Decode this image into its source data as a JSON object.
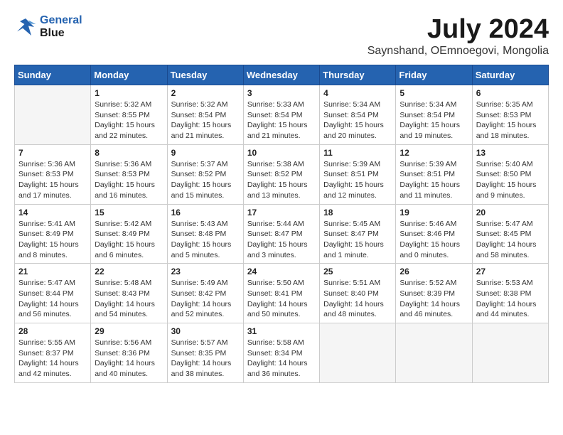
{
  "header": {
    "logo_line1": "General",
    "logo_line2": "Blue",
    "month_year": "July 2024",
    "location": "Saynshand, OEmnoegovi, Mongolia"
  },
  "days_of_week": [
    "Sunday",
    "Monday",
    "Tuesday",
    "Wednesday",
    "Thursday",
    "Friday",
    "Saturday"
  ],
  "weeks": [
    [
      {
        "num": "",
        "info": ""
      },
      {
        "num": "1",
        "info": "Sunrise: 5:32 AM\nSunset: 8:55 PM\nDaylight: 15 hours\nand 22 minutes."
      },
      {
        "num": "2",
        "info": "Sunrise: 5:32 AM\nSunset: 8:54 PM\nDaylight: 15 hours\nand 21 minutes."
      },
      {
        "num": "3",
        "info": "Sunrise: 5:33 AM\nSunset: 8:54 PM\nDaylight: 15 hours\nand 21 minutes."
      },
      {
        "num": "4",
        "info": "Sunrise: 5:34 AM\nSunset: 8:54 PM\nDaylight: 15 hours\nand 20 minutes."
      },
      {
        "num": "5",
        "info": "Sunrise: 5:34 AM\nSunset: 8:54 PM\nDaylight: 15 hours\nand 19 minutes."
      },
      {
        "num": "6",
        "info": "Sunrise: 5:35 AM\nSunset: 8:53 PM\nDaylight: 15 hours\nand 18 minutes."
      }
    ],
    [
      {
        "num": "7",
        "info": "Sunrise: 5:36 AM\nSunset: 8:53 PM\nDaylight: 15 hours\nand 17 minutes."
      },
      {
        "num": "8",
        "info": "Sunrise: 5:36 AM\nSunset: 8:53 PM\nDaylight: 15 hours\nand 16 minutes."
      },
      {
        "num": "9",
        "info": "Sunrise: 5:37 AM\nSunset: 8:52 PM\nDaylight: 15 hours\nand 15 minutes."
      },
      {
        "num": "10",
        "info": "Sunrise: 5:38 AM\nSunset: 8:52 PM\nDaylight: 15 hours\nand 13 minutes."
      },
      {
        "num": "11",
        "info": "Sunrise: 5:39 AM\nSunset: 8:51 PM\nDaylight: 15 hours\nand 12 minutes."
      },
      {
        "num": "12",
        "info": "Sunrise: 5:39 AM\nSunset: 8:51 PM\nDaylight: 15 hours\nand 11 minutes."
      },
      {
        "num": "13",
        "info": "Sunrise: 5:40 AM\nSunset: 8:50 PM\nDaylight: 15 hours\nand 9 minutes."
      }
    ],
    [
      {
        "num": "14",
        "info": "Sunrise: 5:41 AM\nSunset: 8:49 PM\nDaylight: 15 hours\nand 8 minutes."
      },
      {
        "num": "15",
        "info": "Sunrise: 5:42 AM\nSunset: 8:49 PM\nDaylight: 15 hours\nand 6 minutes."
      },
      {
        "num": "16",
        "info": "Sunrise: 5:43 AM\nSunset: 8:48 PM\nDaylight: 15 hours\nand 5 minutes."
      },
      {
        "num": "17",
        "info": "Sunrise: 5:44 AM\nSunset: 8:47 PM\nDaylight: 15 hours\nand 3 minutes."
      },
      {
        "num": "18",
        "info": "Sunrise: 5:45 AM\nSunset: 8:47 PM\nDaylight: 15 hours\nand 1 minute."
      },
      {
        "num": "19",
        "info": "Sunrise: 5:46 AM\nSunset: 8:46 PM\nDaylight: 15 hours\nand 0 minutes."
      },
      {
        "num": "20",
        "info": "Sunrise: 5:47 AM\nSunset: 8:45 PM\nDaylight: 14 hours\nand 58 minutes."
      }
    ],
    [
      {
        "num": "21",
        "info": "Sunrise: 5:47 AM\nSunset: 8:44 PM\nDaylight: 14 hours\nand 56 minutes."
      },
      {
        "num": "22",
        "info": "Sunrise: 5:48 AM\nSunset: 8:43 PM\nDaylight: 14 hours\nand 54 minutes."
      },
      {
        "num": "23",
        "info": "Sunrise: 5:49 AM\nSunset: 8:42 PM\nDaylight: 14 hours\nand 52 minutes."
      },
      {
        "num": "24",
        "info": "Sunrise: 5:50 AM\nSunset: 8:41 PM\nDaylight: 14 hours\nand 50 minutes."
      },
      {
        "num": "25",
        "info": "Sunrise: 5:51 AM\nSunset: 8:40 PM\nDaylight: 14 hours\nand 48 minutes."
      },
      {
        "num": "26",
        "info": "Sunrise: 5:52 AM\nSunset: 8:39 PM\nDaylight: 14 hours\nand 46 minutes."
      },
      {
        "num": "27",
        "info": "Sunrise: 5:53 AM\nSunset: 8:38 PM\nDaylight: 14 hours\nand 44 minutes."
      }
    ],
    [
      {
        "num": "28",
        "info": "Sunrise: 5:55 AM\nSunset: 8:37 PM\nDaylight: 14 hours\nand 42 minutes."
      },
      {
        "num": "29",
        "info": "Sunrise: 5:56 AM\nSunset: 8:36 PM\nDaylight: 14 hours\nand 40 minutes."
      },
      {
        "num": "30",
        "info": "Sunrise: 5:57 AM\nSunset: 8:35 PM\nDaylight: 14 hours\nand 38 minutes."
      },
      {
        "num": "31",
        "info": "Sunrise: 5:58 AM\nSunset: 8:34 PM\nDaylight: 14 hours\nand 36 minutes."
      },
      {
        "num": "",
        "info": ""
      },
      {
        "num": "",
        "info": ""
      },
      {
        "num": "",
        "info": ""
      }
    ]
  ]
}
